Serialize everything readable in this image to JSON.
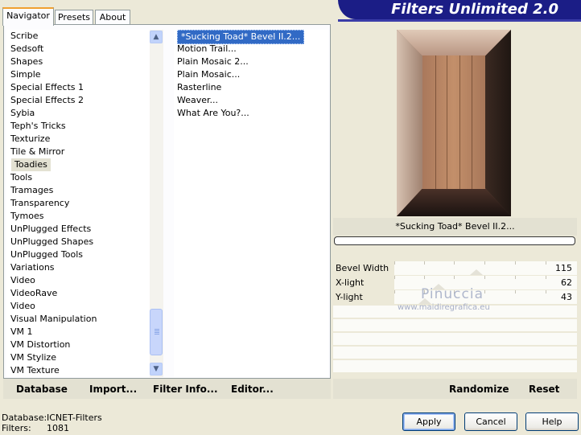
{
  "banner_title": "Filters Unlimited 2.0",
  "tabs": [
    "Navigator",
    "Presets",
    "About"
  ],
  "categories": [
    "Scribe",
    "Sedsoft",
    "Shapes",
    "Simple",
    "Special Effects 1",
    "Special Effects 2",
    "Sybia",
    "Teph's Tricks",
    "Texturize",
    "Tile & Mirror",
    "Toadies",
    "Tools",
    "Tramages",
    "Transparency",
    "Tymoes",
    "UnPlugged Effects",
    "UnPlugged Shapes",
    "UnPlugged Tools",
    "Variations",
    "Video",
    "VideoRave",
    "Video",
    "Visual Manipulation",
    "VM 1",
    "VM Distortion",
    "VM Stylize",
    "VM Texture"
  ],
  "selected_category": "Toadies",
  "filters": [
    "*Sucking Toad*  Bevel II.2...",
    "Motion Trail...",
    "Plain Mosaic 2...",
    "Plain Mosaic...",
    "Rasterline",
    "Weaver...",
    "What Are You?..."
  ],
  "selected_filter": "*Sucking Toad*  Bevel II.2...",
  "preview_name": "*Sucking Toad*  Bevel II.2...",
  "params": [
    {
      "label": "Bevel Width",
      "value": "115",
      "level": 115
    },
    {
      "label": "X-light",
      "value": "62",
      "level": 62
    },
    {
      "label": "Y-light",
      "value": "43",
      "level": 43
    }
  ],
  "watermark": {
    "line1": "Pinuccia",
    "line2": "www.maidiregrafica.eu"
  },
  "bottom_left_buttons": [
    "Database",
    "Import...",
    "Filter Info...",
    "Editor..."
  ],
  "bottom_right_buttons": [
    "Randomize",
    "Reset"
  ],
  "status": {
    "database_label": "Database:",
    "database_value": "ICNET-Filters",
    "filters_label": "Filters:",
    "filters_value": "1081"
  },
  "dialog_buttons": {
    "apply": "Apply",
    "cancel": "Cancel",
    "help": "Help"
  },
  "colors": {
    "banner": "#1b1d86",
    "selection": "#316ac5",
    "face": "#ece9d8"
  }
}
